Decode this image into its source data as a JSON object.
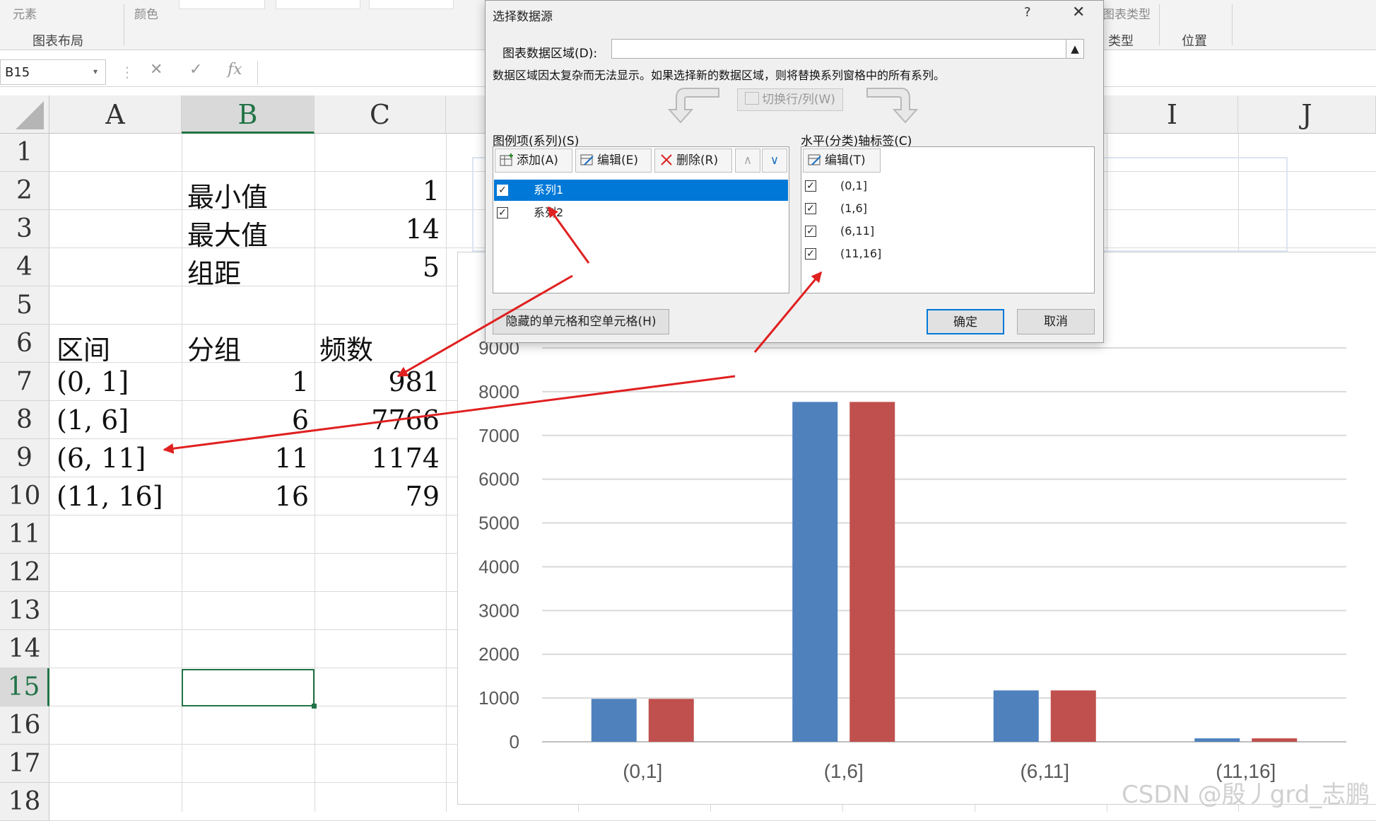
{
  "ribbon": {
    "partial_top_left_1": "元素",
    "partial_top_left_2": "颜色",
    "group_chart_layout": "图表布局",
    "partial_change_type": "图表类型",
    "group_type": "类型",
    "group_location": "位置"
  },
  "formula_bar": {
    "name_box": "B15",
    "cancel_icon": "✕",
    "enter_icon": "✓",
    "fx_label": "fx"
  },
  "sheet": {
    "columns": [
      "A",
      "B",
      "C",
      "I",
      "J"
    ],
    "rows": [
      "1",
      "2",
      "3",
      "4",
      "5",
      "6",
      "7",
      "8",
      "9",
      "10",
      "11",
      "12",
      "13",
      "14",
      "15",
      "16",
      "17",
      "18"
    ],
    "selected_cell": "B15",
    "cells": {
      "B2": "最小值",
      "C2": "1",
      "B3": "最大值",
      "C3": "14",
      "B4": "组距",
      "C4": "5",
      "A6": "区间",
      "B6": "分组",
      "C6": "频数",
      "A7": "(0, 1]",
      "B7": "1",
      "C7": "981",
      "A8": "(1, 6]",
      "B8": "6",
      "C8": "7766",
      "A9": "(6, 11]",
      "B9": "11",
      "C9": "1174",
      "A10": "(11, 16]",
      "B10": "16",
      "C10": "79"
    }
  },
  "chart_data": {
    "type": "bar",
    "categories": [
      "(0,1]",
      "(1,6]",
      "(6,11]",
      "(11,16]"
    ],
    "series": [
      {
        "values": [
          981,
          7766,
          1174,
          79
        ],
        "color": "#4f81bd"
      },
      {
        "values": [
          981,
          7766,
          1174,
          79
        ],
        "color": "#c0504d"
      }
    ],
    "yticks": [
      "0",
      "1000",
      "2000",
      "3000",
      "4000",
      "5000",
      "6000",
      "7000",
      "8000",
      "9000"
    ],
    "ylim": [
      0,
      9000
    ],
    "grid": true,
    "title": "",
    "xlabel": "",
    "ylabel": ""
  },
  "dialog": {
    "title": "选择数据源",
    "help": "?",
    "close": "✕",
    "range_label": "图表数据区域(D):",
    "range_value": "",
    "range_note": "数据区域因太复杂而无法显示。如果选择新的数据区域，则将替换系列窗格中的所有系列。",
    "switch_label": "切换行/列(W)",
    "legend_label": "图例项(系列)(S)",
    "add_label": "添加(A)",
    "edit_label": "编辑(E)",
    "delete_label": "删除(R)",
    "series_items": [
      "系列1",
      "系列2"
    ],
    "axis_label": "水平(分类)轴标签(C)",
    "axis_edit_label": "编辑(T)",
    "axis_items": [
      "(0,1]",
      "(1,6]",
      "(6,11]",
      "(11,16]"
    ],
    "hidden_cells_label": "隐藏的单元格和空单元格(H)",
    "ok_label": "确定",
    "cancel_label": "取消"
  },
  "watermark": "CSDN @殷丿grd_志鹏",
  "colors": {
    "accent_green": "#217346",
    "selection_blue": "#0078d7",
    "arrow_red": "#e02020"
  }
}
